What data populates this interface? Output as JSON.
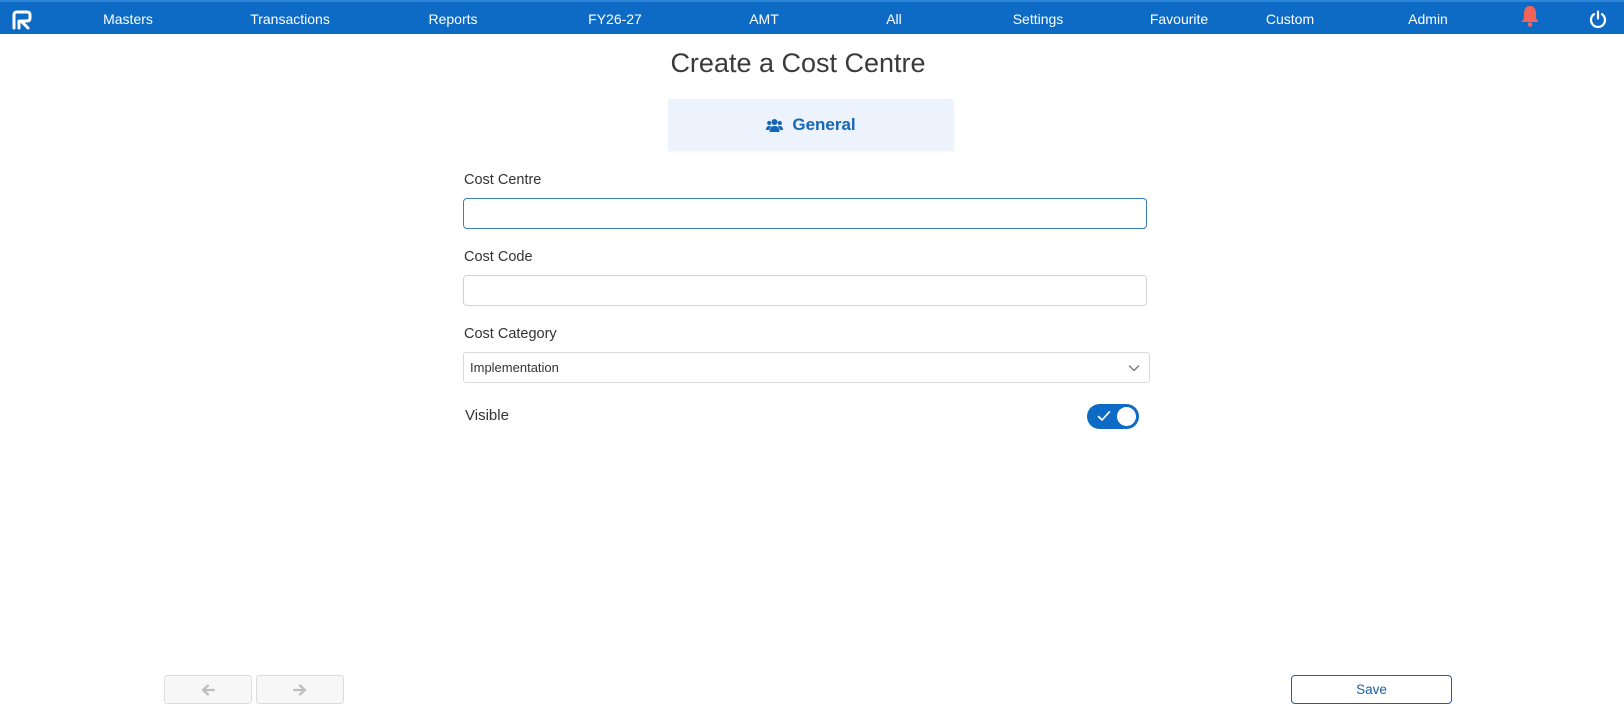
{
  "app": {
    "logo_icon": "app-logo-icon"
  },
  "nav": {
    "items": [
      {
        "label": "Masters"
      },
      {
        "label": "Transactions"
      },
      {
        "label": "Reports"
      },
      {
        "label": "FY26-27"
      },
      {
        "label": "AMT"
      },
      {
        "label": "All"
      },
      {
        "label": "Settings"
      },
      {
        "label": "Favourite"
      },
      {
        "label": "Custom"
      },
      {
        "label": "Admin"
      }
    ],
    "bell_icon": "bell-icon",
    "power_icon": "power-icon"
  },
  "page": {
    "title": "Create a Cost Centre"
  },
  "tabs": {
    "general": {
      "label": "General",
      "icon": "users-icon"
    }
  },
  "form": {
    "cost_centre": {
      "label": "Cost Centre",
      "value": ""
    },
    "cost_code": {
      "label": "Cost Code",
      "value": ""
    },
    "cost_category": {
      "label": "Cost Category",
      "value": "Implementation"
    },
    "visible": {
      "label": "Visible",
      "checked": true
    }
  },
  "footer": {
    "prev_icon": "arrow-left-icon",
    "next_icon": "arrow-right-icon",
    "save_label": "Save"
  },
  "colors": {
    "primary": "#0d6bc6",
    "bell": "#f0645a",
    "tab_bg": "#edf3fc"
  }
}
